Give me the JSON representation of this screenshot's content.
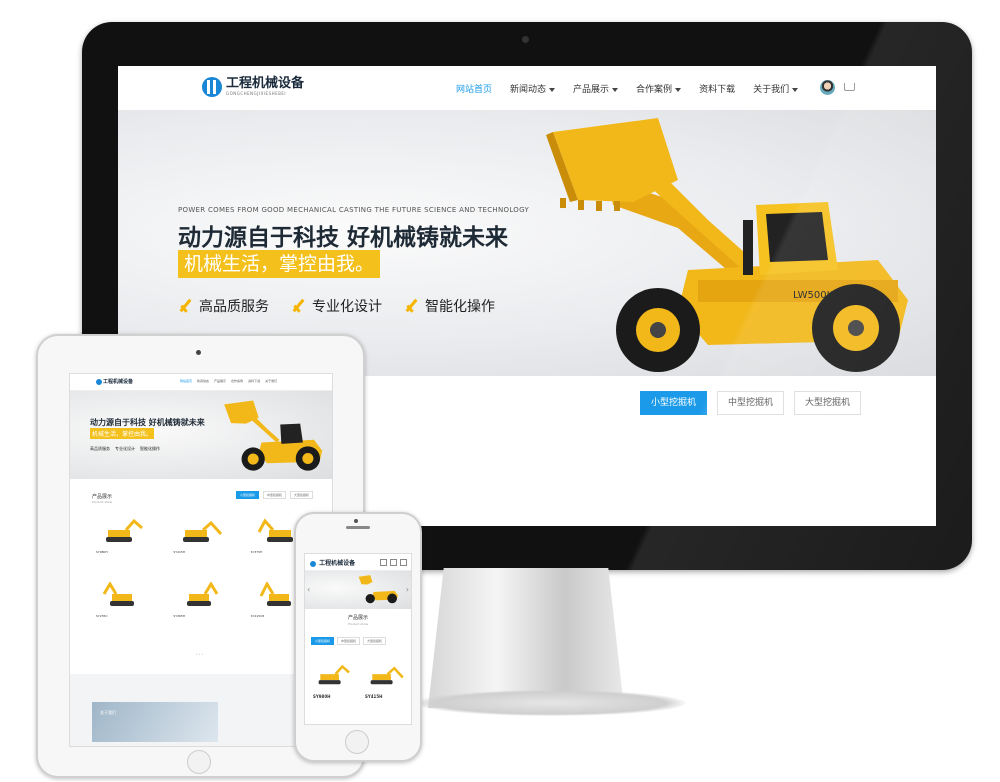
{
  "desktop": {
    "logo": {
      "title": "工程机械设备",
      "subtitle": "GONGCHENGJIXIESHEBEI"
    },
    "menu": [
      {
        "label": "网站首页",
        "active": true,
        "dropdown": false
      },
      {
        "label": "新闻动态",
        "active": false,
        "dropdown": true
      },
      {
        "label": "产品展示",
        "active": false,
        "dropdown": true
      },
      {
        "label": "合作案例",
        "active": false,
        "dropdown": true
      },
      {
        "label": "资料下载",
        "active": false,
        "dropdown": false
      },
      {
        "label": "关于我们",
        "active": false,
        "dropdown": true
      }
    ],
    "banner": {
      "english": "POWER COMES FROM GOOD MECHANICAL CASTING THE FUTURE SCIENCE AND TECHNOLOGY",
      "title": "动力源自于科技  好机械铸就未来",
      "slogan": "机械生活，掌控由我。",
      "features": [
        "高品质服务",
        "专业化设计",
        "智能化操作"
      ],
      "machine_plate": "LW500K",
      "active_slide": 1,
      "slide_count": 3
    },
    "product_tabs": [
      {
        "label": "小型挖掘机",
        "active": true
      },
      {
        "label": "中型挖掘机",
        "active": false
      },
      {
        "label": "大型挖掘机",
        "active": false
      }
    ]
  },
  "tablet": {
    "logo": "工程机械设备",
    "menu": [
      "网站首页",
      "新闻动态",
      "产品展示",
      "合作案例",
      "资料下载",
      "关于我们"
    ],
    "banner_title": "动力源自于科技  好机械铸就未来",
    "banner_slogan": "机械生活，掌控由我。",
    "banner_features": [
      "高品质服务",
      "专业化设计",
      "智能化操作"
    ],
    "section_title": "产品展示",
    "section_sub": "Product show",
    "tabs": [
      "小型挖掘机",
      "中型挖掘机",
      "大型挖掘机"
    ],
    "products": [
      "SY980H",
      "SY415H",
      "SY375H",
      "SY235C",
      "SY365H",
      "SY215C8"
    ],
    "pager": "• • •",
    "about": "关于我们"
  },
  "phone": {
    "logo": "工程机械设备",
    "section_title": "产品展示",
    "section_sub": "Product show",
    "tabs": [
      "小型挖掘机",
      "中型挖掘机",
      "大型挖掘机"
    ],
    "products": [
      "SY980H",
      "SY415H"
    ]
  },
  "colors": {
    "accent": "#1a9ae8",
    "brand_yellow": "#f4c01c",
    "text_dark": "#1e2a35"
  }
}
